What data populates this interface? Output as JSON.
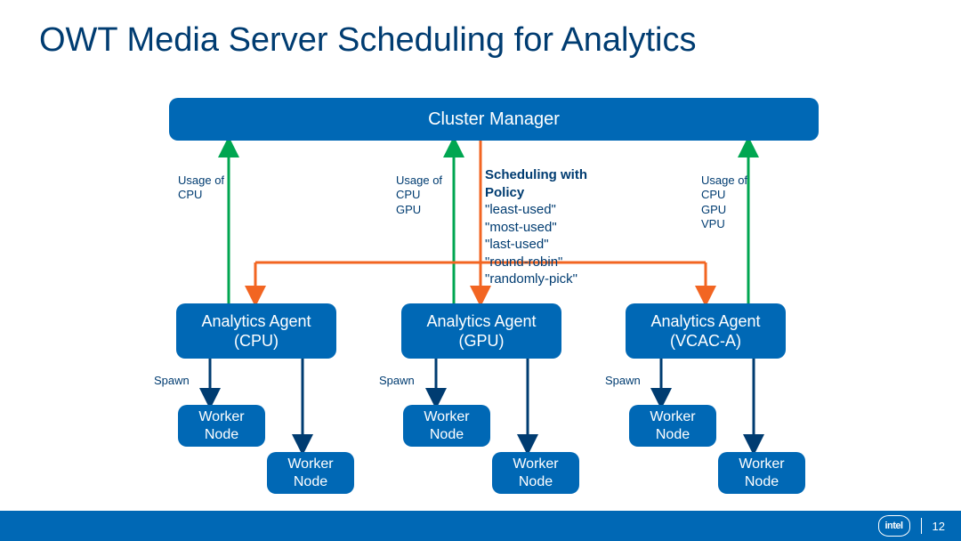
{
  "title": "OWT Media Server Scheduling for Analytics",
  "cluster": {
    "label": "Cluster Manager"
  },
  "agents": {
    "a": {
      "label": "Analytics Agent\n(CPU)"
    },
    "b": {
      "label": "Analytics Agent\n(GPU)"
    },
    "c": {
      "label": "Analytics Agent\n(VCAC-A)"
    }
  },
  "workers": {
    "a1": "Worker\nNode",
    "a2": "Worker\nNode",
    "b1": "Worker\nNode",
    "b2": "Worker\nNode",
    "c1": "Worker\nNode",
    "c2": "Worker\nNode"
  },
  "usage": {
    "a": "Usage of\nCPU",
    "b": "Usage of\nCPU\nGPU",
    "c": "Usage of\nCPU\nGPU\nVPU"
  },
  "spawn": {
    "a": "Spawn",
    "b": "Spawn",
    "c": "Spawn"
  },
  "policy": {
    "header": "Scheduling with\nPolicy",
    "items": [
      "\"least-used\"",
      "\"most-used\"",
      "\"last-used\"",
      "\"round-robin\"",
      "\"randomly-pick\""
    ]
  },
  "colors": {
    "box": "#0068b5",
    "text": "#003c71",
    "greenArrow": "#00a651",
    "orangeArrow": "#f26522",
    "darkArrow": "#003c71"
  },
  "footer": {
    "logo": "intel",
    "page": "12"
  }
}
